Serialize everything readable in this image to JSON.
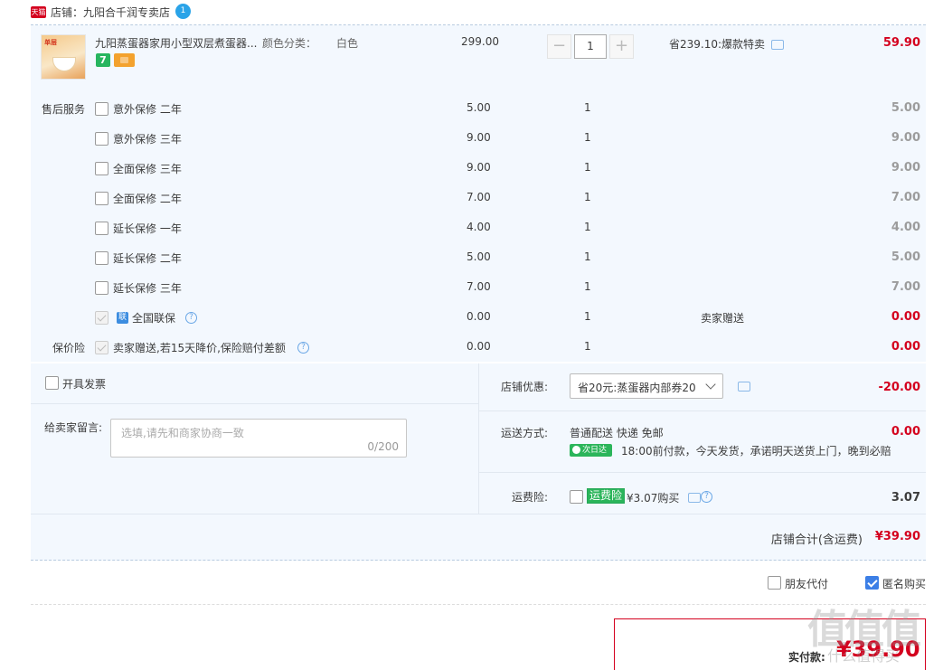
{
  "shop": {
    "logo_text": "天猫",
    "label": "店铺：九阳合千润专卖店",
    "chat_count": "1"
  },
  "item": {
    "thumb_tag": "单层",
    "title": "九阳蒸蛋器家用小型双层煮蛋器...",
    "attr_label": "颜色分类：",
    "attr_value": "白色",
    "badge_7": "7",
    "unit_price": "299.00",
    "quantity": "1",
    "promo": "省239.10:爆款特卖",
    "total": "59.90"
  },
  "services": {
    "group_label": "售后服务",
    "price_protect_label": "保价险",
    "rows": [
      {
        "name": "意外保修 二年",
        "price": "5.00",
        "qty": "1",
        "gift": "",
        "total": "5.00"
      },
      {
        "name": "意外保修 三年",
        "price": "9.00",
        "qty": "1",
        "gift": "",
        "total": "9.00"
      },
      {
        "name": "全面保修 三年",
        "price": "9.00",
        "qty": "1",
        "gift": "",
        "total": "9.00"
      },
      {
        "name": "全面保修 二年",
        "price": "7.00",
        "qty": "1",
        "gift": "",
        "total": "7.00"
      },
      {
        "name": "延长保修 一年",
        "price": "4.00",
        "qty": "1",
        "gift": "",
        "total": "4.00"
      },
      {
        "name": "延长保修 二年",
        "price": "5.00",
        "qty": "1",
        "gift": "",
        "total": "5.00"
      },
      {
        "name": "延长保修 三年",
        "price": "7.00",
        "qty": "1",
        "gift": "",
        "total": "7.00"
      },
      {
        "name": "全国联保",
        "icon_text": "联",
        "price": "0.00",
        "qty": "1",
        "gift": "卖家赠送",
        "total": "0.00"
      },
      {
        "name": "卖家赠送,若15天降价,保险赔付差额",
        "price": "0.00",
        "qty": "1",
        "gift": "",
        "total": "0.00"
      }
    ]
  },
  "invoice": {
    "label": "开具发票"
  },
  "message": {
    "label": "给卖家留言:",
    "placeholder": "选填,请先和商家协商一致",
    "count": "0/200"
  },
  "coupon": {
    "label": "店铺优惠:",
    "selected": "省20元:蒸蛋器内部券20",
    "amount": "-20.00"
  },
  "shipping": {
    "label": "运送方式:",
    "method": "普通配送 快递 免邮",
    "badge": "次日达",
    "promise": "18:00前付款，今天发货，承诺明天送货上门，晚到必赔",
    "fee": "0.00"
  },
  "insurance": {
    "label": "运费险:",
    "tag": "运费险",
    "text": "¥3.07购买",
    "amount": "3.07"
  },
  "store_total": {
    "label": "店铺合计(含运费)",
    "amount": "¥39.90"
  },
  "options": {
    "friend_pay": "朋友代付",
    "anonymous": "匿名购买"
  },
  "payment": {
    "label": "实付款:",
    "amount": "¥39.90"
  },
  "watermark": {
    "main": "值值值",
    "sub": "什么值得买"
  },
  "colors": {
    "accent_red": "#d4001e",
    "panel_bg": "#f3f8fe",
    "check_blue": "#3c7fe6",
    "tmall_red": "#d4001e"
  }
}
